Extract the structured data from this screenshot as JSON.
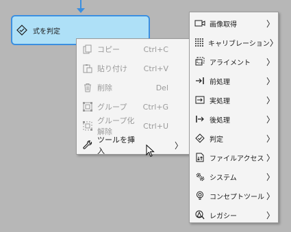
{
  "node": {
    "label": "式を判定",
    "icon": "diamond-check-icon"
  },
  "context_menu": {
    "items": [
      {
        "label": "コピー",
        "shortcut": "Ctrl+C",
        "icon": "copy-icon",
        "enabled": false
      },
      {
        "label": "貼り付け",
        "shortcut": "Ctrl+V",
        "icon": "paste-icon",
        "enabled": false
      },
      {
        "label": "削除",
        "shortcut": "Del",
        "icon": "trash-icon",
        "enabled": false
      },
      {
        "label": "グループ",
        "shortcut": "Ctrl+G",
        "icon": "group-icon",
        "enabled": false
      },
      {
        "label": "グループ化解除",
        "shortcut": "Ctrl+U",
        "icon": "ungroup-icon",
        "enabled": false
      },
      {
        "label": "ツールを挿入",
        "shortcut": "",
        "icon": "wrench-icon",
        "enabled": true,
        "submenu": true
      }
    ]
  },
  "submenu": {
    "items": [
      {
        "label": "画像取得",
        "icon": "camera-icon"
      },
      {
        "label": "キャリブレーション",
        "icon": "calibration-grid-icon"
      },
      {
        "label": "アライメント",
        "icon": "alignment-icon"
      },
      {
        "label": "前処理",
        "icon": "preprocess-icon"
      },
      {
        "label": "実処理",
        "icon": "process-icon"
      },
      {
        "label": "後処理",
        "icon": "postprocess-icon"
      },
      {
        "label": "判定",
        "icon": "judge-icon"
      },
      {
        "label": "ファイルアクセス",
        "icon": "file-access-icon"
      },
      {
        "label": "システム",
        "icon": "gears-icon"
      },
      {
        "label": "コンセプトツール",
        "icon": "bulb-icon"
      },
      {
        "label": "レガシー",
        "icon": "legacy-icon"
      }
    ]
  },
  "chevron": "〉",
  "colors": {
    "accent": "#3b8fe0",
    "node_fill": "#aee0f7",
    "background": "#b7b7b7",
    "menu_bg": "#f4f4f4",
    "disabled_text": "#9a9a9a"
  }
}
